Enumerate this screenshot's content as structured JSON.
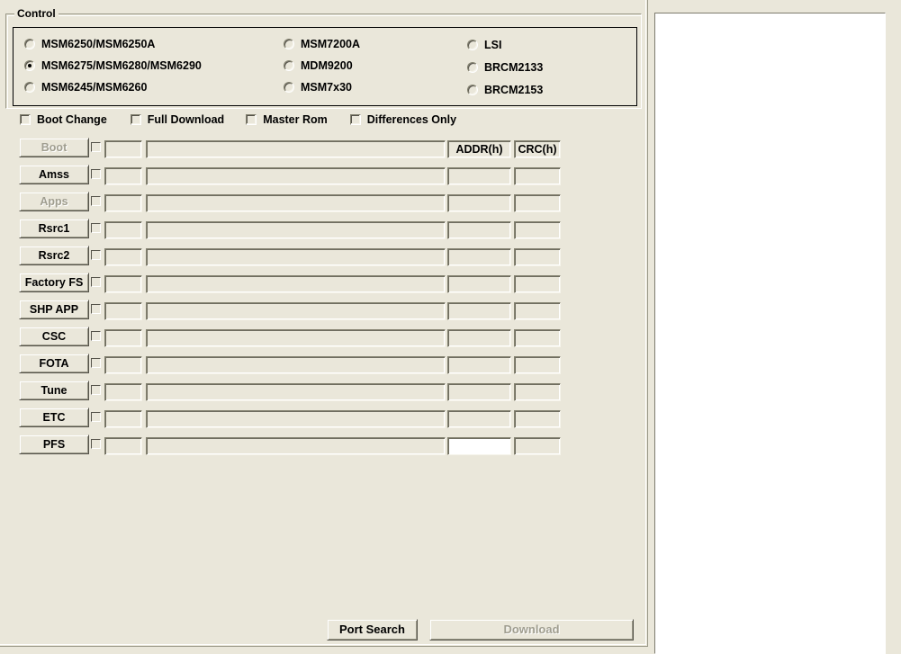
{
  "window": {
    "background_color": "#eae7da"
  },
  "control_group": {
    "title": "Control",
    "chipsets": {
      "column1": [
        {
          "label": "MSM6250/MSM6250A",
          "selected": false
        },
        {
          "label": "MSM6275/MSM6280/MSM6290",
          "selected": true
        },
        {
          "label": "MSM6245/MSM6260",
          "selected": false
        }
      ],
      "column2": [
        {
          "label": "MSM7200A",
          "selected": false
        },
        {
          "label": "MDM9200",
          "selected": false
        },
        {
          "label": "MSM7x30",
          "selected": false
        }
      ],
      "column3": [
        {
          "label": "LSI",
          "selected": false
        },
        {
          "label": "BRCM2133",
          "selected": false
        },
        {
          "label": "BRCM2153",
          "selected": false
        }
      ]
    }
  },
  "options": [
    {
      "label": "Boot Change",
      "checked": false
    },
    {
      "label": "Full Download",
      "checked": false
    },
    {
      "label": "Master Rom",
      "checked": false
    },
    {
      "label": "Differences Only",
      "checked": false
    }
  ],
  "table": {
    "addr_header": "ADDR(h)",
    "crc_header": "CRC(h)",
    "rows": [
      {
        "button": "Boot",
        "enabled": false,
        "checked": false,
        "size": "",
        "path": "",
        "addr": "",
        "crc": "",
        "addr_focused": false
      },
      {
        "button": "Amss",
        "enabled": true,
        "checked": false,
        "size": "",
        "path": "",
        "addr": "",
        "crc": "",
        "addr_focused": false
      },
      {
        "button": "Apps",
        "enabled": false,
        "checked": false,
        "size": "",
        "path": "",
        "addr": "",
        "crc": "",
        "addr_focused": false
      },
      {
        "button": "Rsrc1",
        "enabled": true,
        "checked": false,
        "size": "",
        "path": "",
        "addr": "",
        "crc": "",
        "addr_focused": false
      },
      {
        "button": "Rsrc2",
        "enabled": true,
        "checked": false,
        "size": "",
        "path": "",
        "addr": "",
        "crc": "",
        "addr_focused": false
      },
      {
        "button": "Factory FS",
        "enabled": true,
        "checked": false,
        "size": "",
        "path": "",
        "addr": "",
        "crc": "",
        "addr_focused": false
      },
      {
        "button": "SHP APP",
        "enabled": true,
        "checked": false,
        "size": "",
        "path": "",
        "addr": "",
        "crc": "",
        "addr_focused": false
      },
      {
        "button": "CSC",
        "enabled": true,
        "checked": false,
        "size": "",
        "path": "",
        "addr": "",
        "crc": "",
        "addr_focused": false
      },
      {
        "button": "FOTA",
        "enabled": true,
        "checked": false,
        "size": "",
        "path": "",
        "addr": "",
        "crc": "",
        "addr_focused": false
      },
      {
        "button": "Tune",
        "enabled": true,
        "checked": false,
        "size": "",
        "path": "",
        "addr": "",
        "crc": "",
        "addr_focused": false
      },
      {
        "button": "ETC",
        "enabled": true,
        "checked": false,
        "size": "",
        "path": "",
        "addr": "",
        "crc": "",
        "addr_focused": false
      },
      {
        "button": "PFS",
        "enabled": true,
        "checked": false,
        "size": "",
        "path": "",
        "addr": "",
        "crc": "",
        "addr_focused": true
      }
    ]
  },
  "actions": {
    "port_search": {
      "label": "Port Search",
      "enabled": true
    },
    "download": {
      "label": "Download",
      "enabled": false
    }
  },
  "log_panel": {
    "content": ""
  }
}
